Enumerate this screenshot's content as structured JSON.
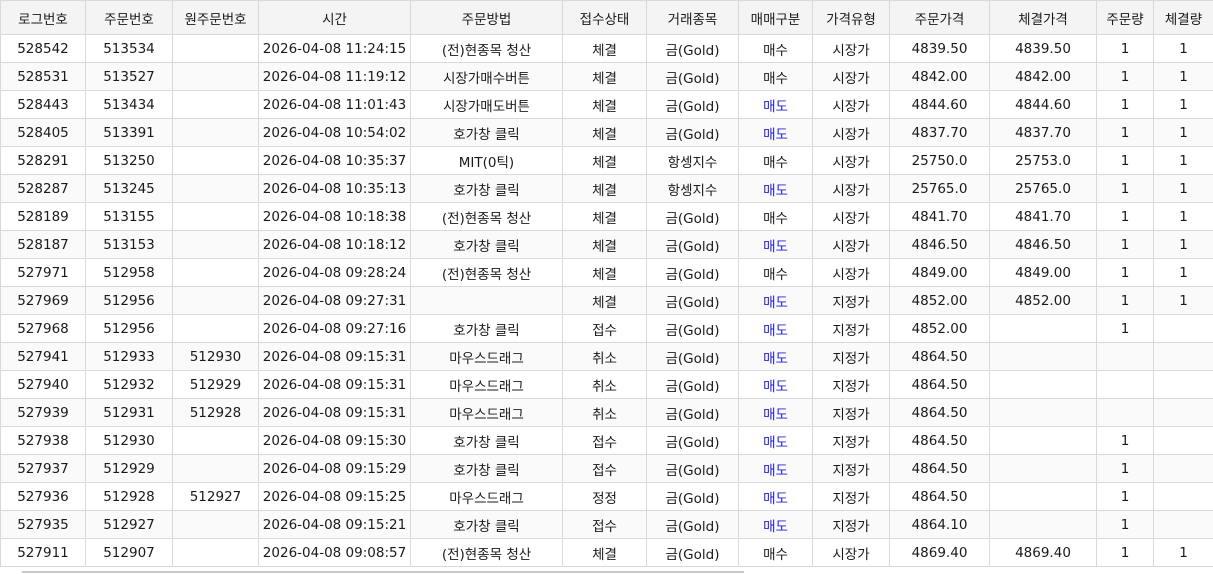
{
  "columns": [
    "로그번호",
    "주문번호",
    "원주문번호",
    "시간",
    "주문방법",
    "접수상태",
    "거래종목",
    "매매구분",
    "가격유형",
    "주문가격",
    "체결가격",
    "주문량",
    "체결량"
  ],
  "accent": {
    "sell_color": "#1f1fd6"
  },
  "rows": [
    [
      "528542",
      "513534",
      "",
      "2026-04-08 11:24:15",
      "(전)현종목 청산",
      "체결",
      "금(Gold)",
      "매수",
      "시장가",
      "4839.50",
      "4839.50",
      "1",
      "1"
    ],
    [
      "528531",
      "513527",
      "",
      "2026-04-08 11:19:12",
      "시장가매수버튼",
      "체결",
      "금(Gold)",
      "매수",
      "시장가",
      "4842.00",
      "4842.00",
      "1",
      "1"
    ],
    [
      "528443",
      "513434",
      "",
      "2026-04-08 11:01:43",
      "시장가매도버튼",
      "체결",
      "금(Gold)",
      "매도",
      "시장가",
      "4844.60",
      "4844.60",
      "1",
      "1"
    ],
    [
      "528405",
      "513391",
      "",
      "2026-04-08 10:54:02",
      "호가창 클릭",
      "체결",
      "금(Gold)",
      "매도",
      "시장가",
      "4837.70",
      "4837.70",
      "1",
      "1"
    ],
    [
      "528291",
      "513250",
      "",
      "2026-04-08 10:35:37",
      "MIT(0틱)",
      "체결",
      "항셍지수",
      "매수",
      "시장가",
      "25750.0",
      "25753.0",
      "1",
      "1"
    ],
    [
      "528287",
      "513245",
      "",
      "2026-04-08 10:35:13",
      "호가창 클릭",
      "체결",
      "항셍지수",
      "매도",
      "시장가",
      "25765.0",
      "25765.0",
      "1",
      "1"
    ],
    [
      "528189",
      "513155",
      "",
      "2026-04-08 10:18:38",
      "(전)현종목 청산",
      "체결",
      "금(Gold)",
      "매수",
      "시장가",
      "4841.70",
      "4841.70",
      "1",
      "1"
    ],
    [
      "528187",
      "513153",
      "",
      "2026-04-08 10:18:12",
      "호가창 클릭",
      "체결",
      "금(Gold)",
      "매도",
      "시장가",
      "4846.50",
      "4846.50",
      "1",
      "1"
    ],
    [
      "527971",
      "512958",
      "",
      "2026-04-08 09:28:24",
      "(전)현종목 청산",
      "체결",
      "금(Gold)",
      "매수",
      "시장가",
      "4849.00",
      "4849.00",
      "1",
      "1"
    ],
    [
      "527969",
      "512956",
      "",
      "2026-04-08 09:27:31",
      "",
      "체결",
      "금(Gold)",
      "매도",
      "지정가",
      "4852.00",
      "4852.00",
      "1",
      "1"
    ],
    [
      "527968",
      "512956",
      "",
      "2026-04-08 09:27:16",
      "호가창 클릭",
      "접수",
      "금(Gold)",
      "매도",
      "지정가",
      "4852.00",
      "",
      "1",
      ""
    ],
    [
      "527941",
      "512933",
      "512930",
      "2026-04-08 09:15:31",
      "마우스드래그",
      "취소",
      "금(Gold)",
      "매도",
      "지정가",
      "4864.50",
      "",
      "",
      ""
    ],
    [
      "527940",
      "512932",
      "512929",
      "2026-04-08 09:15:31",
      "마우스드래그",
      "취소",
      "금(Gold)",
      "매도",
      "지정가",
      "4864.50",
      "",
      "",
      ""
    ],
    [
      "527939",
      "512931",
      "512928",
      "2026-04-08 09:15:31",
      "마우스드래그",
      "취소",
      "금(Gold)",
      "매도",
      "지정가",
      "4864.50",
      "",
      "",
      ""
    ],
    [
      "527938",
      "512930",
      "",
      "2026-04-08 09:15:30",
      "호가창 클릭",
      "접수",
      "금(Gold)",
      "매도",
      "지정가",
      "4864.50",
      "",
      "1",
      ""
    ],
    [
      "527937",
      "512929",
      "",
      "2026-04-08 09:15:29",
      "호가창 클릭",
      "접수",
      "금(Gold)",
      "매도",
      "지정가",
      "4864.50",
      "",
      "1",
      ""
    ],
    [
      "527936",
      "512928",
      "512927",
      "2026-04-08 09:15:25",
      "마우스드래그",
      "정정",
      "금(Gold)",
      "매도",
      "지정가",
      "4864.50",
      "",
      "1",
      ""
    ],
    [
      "527935",
      "512927",
      "",
      "2026-04-08 09:15:21",
      "호가창 클릭",
      "접수",
      "금(Gold)",
      "매도",
      "지정가",
      "4864.10",
      "",
      "1",
      ""
    ],
    [
      "527911",
      "512907",
      "",
      "2026-04-08 09:08:57",
      "(전)현종목 청산",
      "체결",
      "금(Gold)",
      "매수",
      "시장가",
      "4869.40",
      "4869.40",
      "1",
      "1"
    ]
  ]
}
